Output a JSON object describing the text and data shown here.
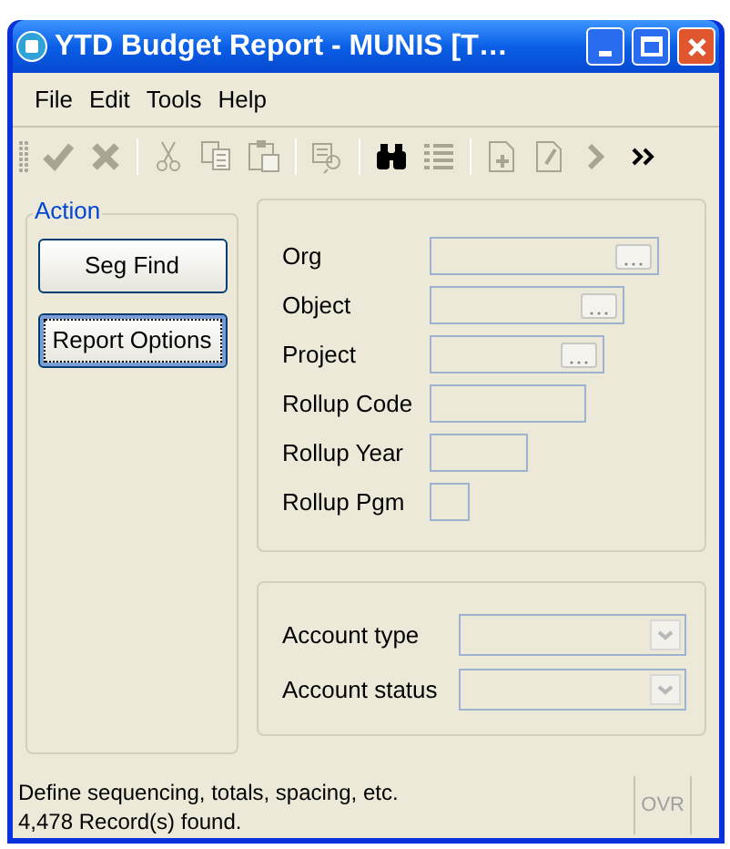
{
  "window": {
    "title": "YTD Budget Report - MUNIS [T…"
  },
  "menu": [
    {
      "label": "File"
    },
    {
      "label": "Edit"
    },
    {
      "label": "Tools"
    },
    {
      "label": "Help"
    }
  ],
  "toolbar": [
    {
      "kind": "check",
      "disabled": true
    },
    {
      "kind": "cross",
      "disabled": true
    },
    {
      "kind": "sep"
    },
    {
      "kind": "scissors",
      "disabled": true
    },
    {
      "kind": "copy",
      "disabled": true
    },
    {
      "kind": "paste",
      "disabled": true
    },
    {
      "kind": "sep"
    },
    {
      "kind": "preview",
      "disabled": true
    },
    {
      "kind": "sep"
    },
    {
      "kind": "binoculars",
      "disabled": false
    },
    {
      "kind": "list",
      "disabled": true
    },
    {
      "kind": "sep"
    },
    {
      "kind": "newdoc",
      "disabled": true
    },
    {
      "kind": "editdoc",
      "disabled": true
    },
    {
      "kind": "next",
      "disabled": true
    },
    {
      "kind": "more",
      "disabled": false
    }
  ],
  "action": {
    "title": "Action",
    "buttons": [
      {
        "label": "Seg Find",
        "focused": false
      },
      {
        "label": "Report Options",
        "focused": true
      }
    ]
  },
  "fields": [
    {
      "label": "Org",
      "lookup": true
    },
    {
      "label": "Object",
      "lookup": true
    },
    {
      "label": "Project",
      "lookup": true
    },
    {
      "label": "Rollup Code",
      "lookup": false
    },
    {
      "label": "Rollup Year",
      "lookup": false
    },
    {
      "label": "Rollup Pgm",
      "lookup": false
    }
  ],
  "dropdowns": [
    {
      "label": "Account type"
    },
    {
      "label": "Account status"
    }
  ],
  "status_bar": {
    "lines": [
      "Define sequencing, totals, spacing, etc.",
      "4,478 Record(s) found."
    ],
    "mode": "OVR"
  }
}
